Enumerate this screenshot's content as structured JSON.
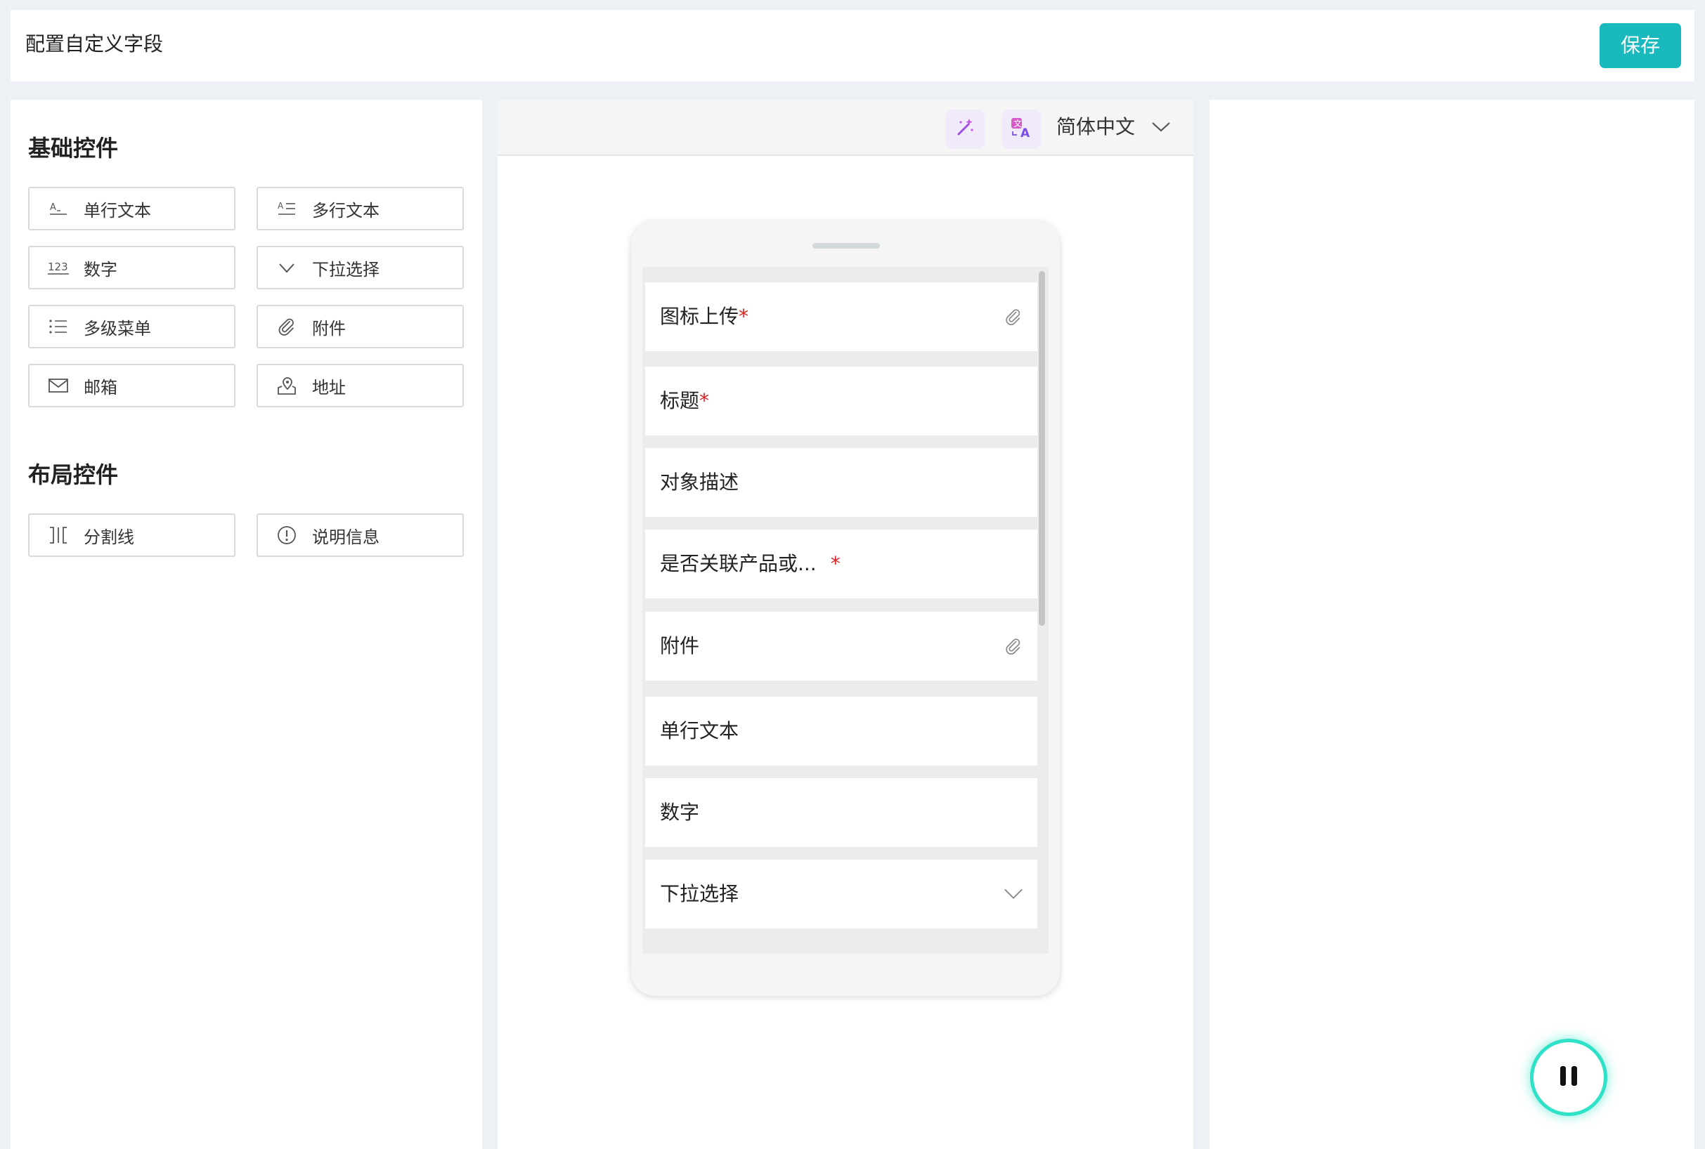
{
  "header": {
    "title": "配置自定义字段",
    "save_label": "保存"
  },
  "left_panel": {
    "basic_title": "基础控件",
    "basic_controls": [
      {
        "label": "单行文本",
        "icon": "single-line-text-icon"
      },
      {
        "label": "多行文本",
        "icon": "multi-line-text-icon"
      },
      {
        "label": "数字",
        "icon": "number-icon"
      },
      {
        "label": "下拉选择",
        "icon": "chevron-down-icon"
      },
      {
        "label": "多级菜单",
        "icon": "list-icon"
      },
      {
        "label": "附件",
        "icon": "paperclip-icon"
      },
      {
        "label": "邮箱",
        "icon": "mail-icon"
      },
      {
        "label": "地址",
        "icon": "map-pin-icon"
      }
    ],
    "layout_title": "布局控件",
    "layout_controls": [
      {
        "label": "分割线",
        "icon": "divider-icon"
      },
      {
        "label": "说明信息",
        "icon": "info-icon"
      }
    ]
  },
  "toolbar": {
    "language": "简体中文"
  },
  "preview": {
    "fields": [
      {
        "label": "图标上传",
        "required": true,
        "icon": "paperclip-icon"
      },
      {
        "label": "标题",
        "required": true
      },
      {
        "label": "对象描述",
        "required": false
      },
      {
        "label": "是否关联产品或...",
        "required": true
      },
      {
        "label": "附件",
        "required": false,
        "icon": "paperclip-icon"
      },
      {
        "label": "单行文本",
        "required": false
      },
      {
        "label": "数字",
        "required": false
      },
      {
        "label": "下拉选择",
        "required": false,
        "icon": "chevron-down-icon"
      }
    ],
    "required_mark": "*"
  },
  "colors": {
    "accent": "#19b9bd",
    "required": "#e02020",
    "ai_purple": "#9b4de0"
  }
}
